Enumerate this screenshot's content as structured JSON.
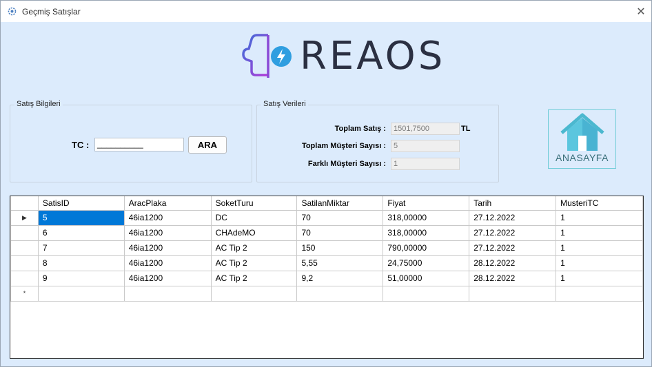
{
  "window": {
    "title": "Geçmiş Satışlar",
    "close_glyph": "✕"
  },
  "logo": {
    "brand": "REAOS"
  },
  "satis_bilgileri": {
    "legend": "Satış Bilgileri",
    "tc_label": "TC :",
    "tc_value": "__________",
    "search_button": "ARA"
  },
  "satis_verileri": {
    "legend": "Satış Verileri",
    "toplam_satis_label": "Toplam Satış :",
    "toplam_satis_value": "1501,7500",
    "toplam_satis_unit": "TL",
    "toplam_musteri_label": "Toplam Müşteri Sayısı :",
    "toplam_musteri_value": "5",
    "farkli_musteri_label": "Farklı Müşteri Sayısı :",
    "farkli_musteri_value": "1"
  },
  "home": {
    "label": "ANASAYFA",
    "icon": "home-icon",
    "accent": "#4bb8cf"
  },
  "grid": {
    "columns": [
      "SatisID",
      "AracPlaka",
      "SoketTuru",
      "SatilanMiktar",
      "Fiyat",
      "Tarih",
      "MusteriTC"
    ],
    "rows": [
      [
        "5",
        "46ia1200",
        "DC",
        "70",
        "318,00000",
        "27.12.2022",
        "1"
      ],
      [
        "6",
        "46ia1200",
        "CHAdeMO",
        "70",
        "318,00000",
        "27.12.2022",
        "1"
      ],
      [
        "7",
        "46ia1200",
        "AC Tip 2",
        "150",
        "790,00000",
        "27.12.2022",
        "1"
      ],
      [
        "8",
        "46ia1200",
        "AC Tip 2",
        "5,55",
        "24,75000",
        "28.12.2022",
        "1"
      ],
      [
        "9",
        "46ia1200",
        "AC Tip 2",
        "9,2",
        "51,00000",
        "28.12.2022",
        "1"
      ]
    ],
    "current_row_glyph": "▶",
    "new_row_glyph": "*",
    "selection_color": "#0078d7"
  }
}
